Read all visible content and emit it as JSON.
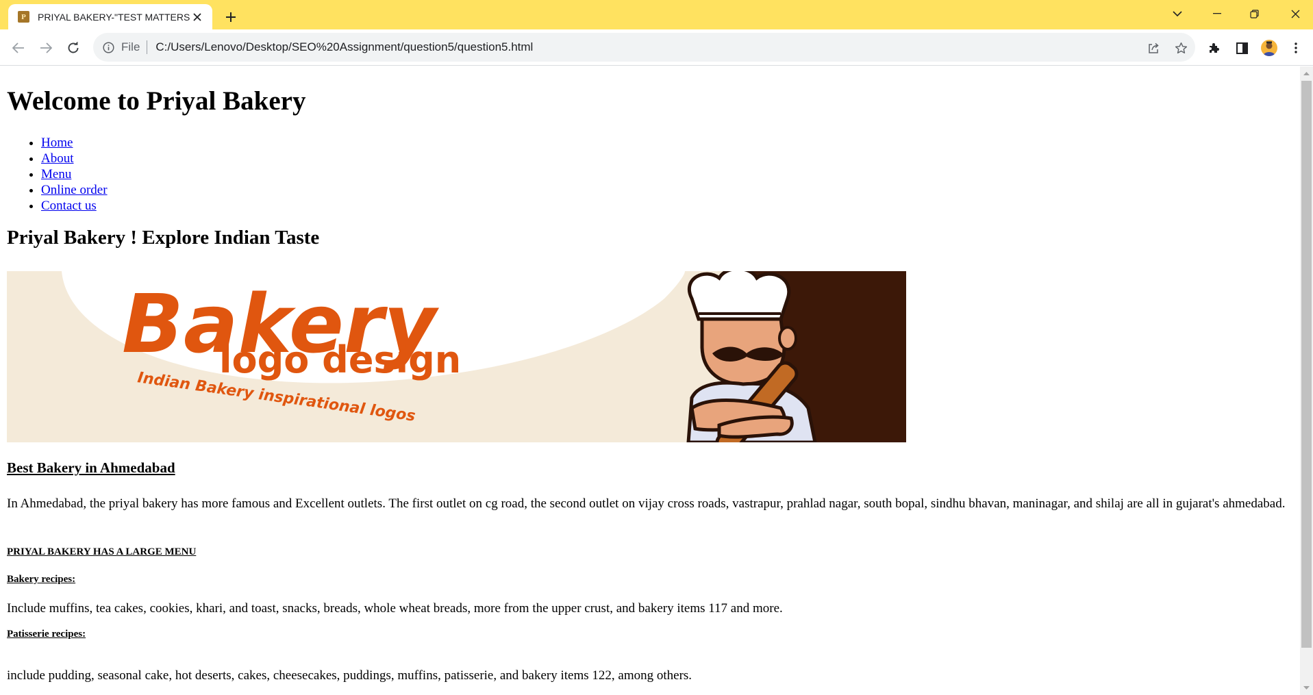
{
  "browser": {
    "tab_title": "PRIYAL BAKERY-\"TEST MATTERS",
    "favicon_letter": "P",
    "url_scheme_label": "File",
    "url": "C:/Users/Lenovo/Desktop/SEO%20Assignment/question5/question5.html",
    "colors": {
      "tabbar": "#ffe260",
      "omnibox": "#f1f3f4"
    },
    "icons": [
      "back-icon",
      "forward-icon",
      "reload-icon",
      "info-icon",
      "share-icon",
      "star-icon",
      "extensions-icon",
      "sidepanel-icon",
      "avatar",
      "menu-dots-icon",
      "tab-search-chevron-icon",
      "minimize-icon",
      "restore-icon",
      "close-window-icon"
    ]
  },
  "page": {
    "heading": "Welcome to Priyal Bakery",
    "nav_links": [
      {
        "label": "Home"
      },
      {
        "label": "About"
      },
      {
        "label": "Menu"
      },
      {
        "label": "Online order"
      },
      {
        "label": "Contact us"
      }
    ],
    "subheading": "Priyal Bakery ! Explore Indian Taste",
    "banner": {
      "title": "Bakery",
      "subtitle": "logo design",
      "tagline": "Indian Bakery inspirational logos"
    },
    "section_title": "Best Bakery in Ahmedabad",
    "intro": "In Ahmedabad, the priyal bakery has more famous and Excellent outlets. The first outlet on cg road, the second outlet on vijay cross roads, vastrapur, prahlad nagar, south bopal, sindhu bhavan, maninagar, and shilaj are all in gujarat's ahmedabad.",
    "menu_heading": "PRIYAL BAKERY HAS A LARGE MENU",
    "bakery_heading": "Bakery recipes:",
    "bakery_text": "Include muffins, tea cakes, cookies, khari, and toast, snacks, breads, whole wheat breads, more from the upper crust, and bakery items 117 and more.",
    "patisserie_heading": "Patisserie recipes:",
    "patisserie_text": "include pudding, seasonal cake, hot deserts, cakes, cheesecakes, puddings, muffins, patisserie, and bakery items 122, among others."
  }
}
